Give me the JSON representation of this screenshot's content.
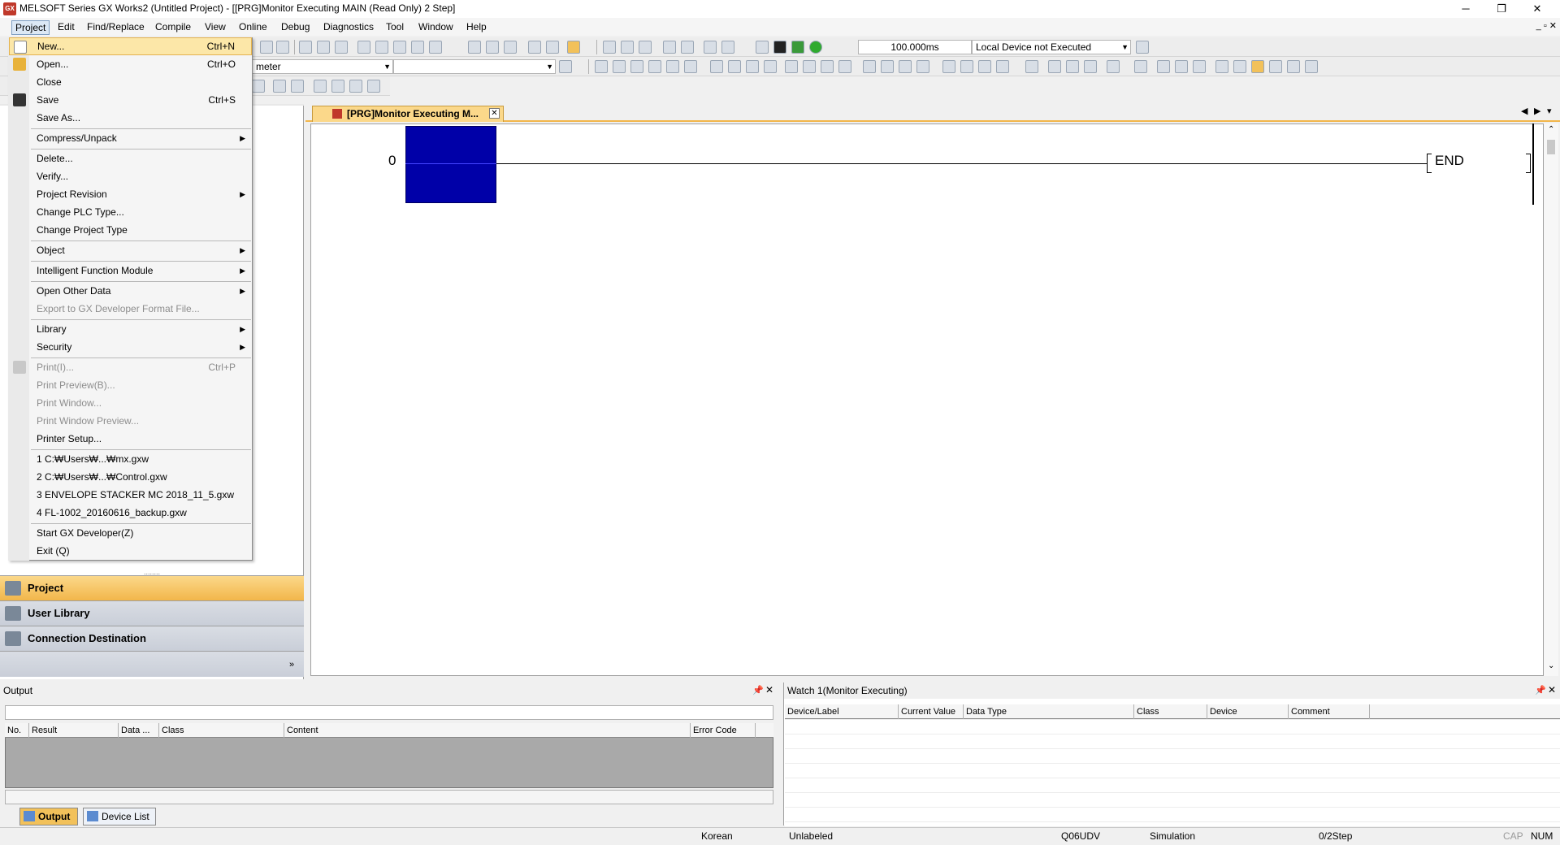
{
  "window": {
    "title": "MELSOFT Series GX Works2 (Untitled Project) - [[PRG]Monitor Executing MAIN (Read Only) 2 Step]",
    "controls": [
      "─",
      "❐",
      "✕"
    ],
    "mdi_controls": "_ ▫ ✕"
  },
  "menubar": {
    "items": [
      "Project",
      "Edit",
      "Find/Replace",
      "Compile",
      "View",
      "Online",
      "Debug",
      "Diagnostics",
      "Tool",
      "Window",
      "Help"
    ]
  },
  "toolbar": {
    "monitor_interval": "100.000ms",
    "local_device": "Local Device not Executed",
    "parameter_combo": "meter"
  },
  "project_menu": {
    "items": [
      {
        "label": "New...",
        "shortcut": "Ctrl+N",
        "submenu": false,
        "disabled": false,
        "highlighted": true,
        "icon": "new-file-icon"
      },
      {
        "label": "Open...",
        "shortcut": "Ctrl+O",
        "submenu": false,
        "disabled": false,
        "icon": "open-folder-icon"
      },
      {
        "label": "Close",
        "shortcut": "",
        "submenu": false,
        "disabled": false
      },
      {
        "label": "Save",
        "shortcut": "Ctrl+S",
        "submenu": false,
        "disabled": false,
        "icon": "save-icon"
      },
      {
        "label": "Save As...",
        "shortcut": "",
        "submenu": false,
        "disabled": false
      },
      {
        "label": "Compress/Unpack",
        "shortcut": "",
        "submenu": true,
        "disabled": false
      },
      {
        "label": "Delete...",
        "shortcut": "",
        "submenu": false,
        "disabled": false
      },
      {
        "label": "Verify...",
        "shortcut": "",
        "submenu": false,
        "disabled": false
      },
      {
        "label": "Project Revision",
        "shortcut": "",
        "submenu": true,
        "disabled": false
      },
      {
        "label": "Change PLC Type...",
        "shortcut": "",
        "submenu": false,
        "disabled": false
      },
      {
        "label": "Change Project Type",
        "shortcut": "",
        "submenu": false,
        "disabled": false
      },
      {
        "label": "Object",
        "shortcut": "",
        "submenu": true,
        "disabled": false
      },
      {
        "label": "Intelligent Function Module",
        "shortcut": "",
        "submenu": true,
        "disabled": false
      },
      {
        "label": "Open Other Data",
        "shortcut": "",
        "submenu": true,
        "disabled": false
      },
      {
        "label": "Export to GX Developer Format File...",
        "shortcut": "",
        "submenu": false,
        "disabled": true
      },
      {
        "label": "Library",
        "shortcut": "",
        "submenu": true,
        "disabled": false
      },
      {
        "label": "Security",
        "shortcut": "",
        "submenu": true,
        "disabled": false
      },
      {
        "label": "Print(I)...",
        "shortcut": "Ctrl+P",
        "submenu": false,
        "disabled": true,
        "icon": "print-icon"
      },
      {
        "label": "Print Preview(B)...",
        "shortcut": "",
        "submenu": false,
        "disabled": true
      },
      {
        "label": "Print Window...",
        "shortcut": "",
        "submenu": false,
        "disabled": true
      },
      {
        "label": "Print Window Preview...",
        "shortcut": "",
        "submenu": false,
        "disabled": true
      },
      {
        "label": "Printer Setup...",
        "shortcut": "",
        "submenu": false,
        "disabled": false
      },
      {
        "label": "1 C:₩Users₩...₩mx.gxw",
        "shortcut": "",
        "submenu": false,
        "disabled": false
      },
      {
        "label": "2 C:₩Users₩...₩Control.gxw",
        "shortcut": "",
        "submenu": false,
        "disabled": false
      },
      {
        "label": "3 ENVELOPE STACKER MC 2018_11_5.gxw",
        "shortcut": "",
        "submenu": false,
        "disabled": false
      },
      {
        "label": "4 FL-1002_20160616_backup.gxw",
        "shortcut": "",
        "submenu": false,
        "disabled": false
      },
      {
        "label": "Start GX Developer(Z)",
        "shortcut": "",
        "submenu": false,
        "disabled": false
      },
      {
        "label": "Exit (Q)",
        "shortcut": "",
        "submenu": false,
        "disabled": false
      }
    ]
  },
  "navigation": {
    "buttons": [
      {
        "label": "Project",
        "active": true
      },
      {
        "label": "User Library",
        "active": false
      },
      {
        "label": "Connection Destination",
        "active": false
      }
    ]
  },
  "editor": {
    "tab_label": "[PRG]Monitor Executing M...",
    "rung_number": "0",
    "end_label": "END"
  },
  "output_pane": {
    "title": "Output",
    "columns": [
      "No.",
      "Result",
      "Data ...",
      "Class",
      "Content",
      "Error Code"
    ],
    "tabs": [
      "Output",
      "Device List"
    ]
  },
  "watch_pane": {
    "title": "Watch 1(Monitor Executing)",
    "columns": [
      "Device/Label",
      "Current Value",
      "Data Type",
      "Class",
      "Device",
      "Comment"
    ]
  },
  "statusbar": {
    "language": "Korean",
    "label": "Unlabeled",
    "plc_type": "Q06UDV",
    "mode": "Simulation",
    "steps": "0/2Step",
    "cap": "CAP",
    "num": "NUM"
  }
}
